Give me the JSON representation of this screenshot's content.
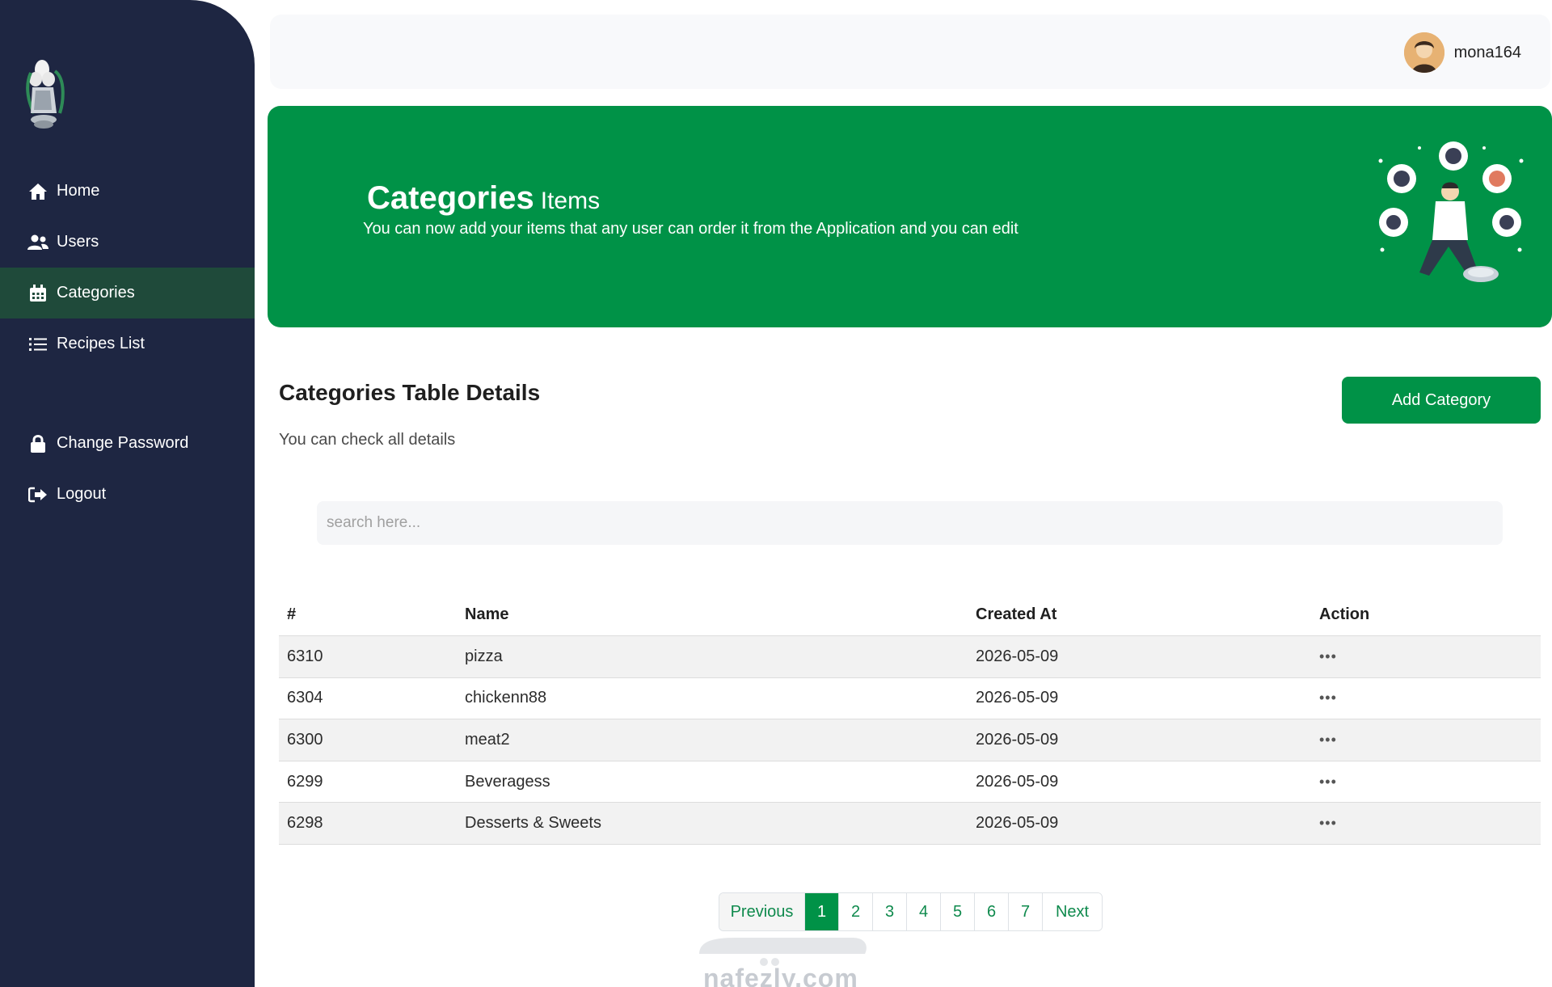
{
  "sidebar": {
    "items": [
      {
        "label": "Home",
        "icon": "home-icon"
      },
      {
        "label": "Users",
        "icon": "users-icon"
      },
      {
        "label": "Categories",
        "icon": "calendar-icon"
      },
      {
        "label": "Recipes List",
        "icon": "list-icon"
      },
      {
        "label": "Change Password",
        "icon": "lock-icon"
      },
      {
        "label": "Logout",
        "icon": "logout-icon"
      }
    ],
    "active": "Categories"
  },
  "topbar": {
    "username": "mona164"
  },
  "banner": {
    "title_big": "Categories",
    "title_small": "Items",
    "subtitle": "You can now add your items that any user can order it from the Application and you can edit"
  },
  "section": {
    "title": "Categories Table Details",
    "subtitle": "You can check all details",
    "add_button": "Add Category"
  },
  "search": {
    "placeholder": "search here..."
  },
  "table": {
    "headers": [
      "#",
      "Name",
      "Created At",
      "Action"
    ],
    "rows": [
      {
        "id": "6310",
        "name": "pizza",
        "created": "2026-05-09",
        "action": "•••"
      },
      {
        "id": "6304",
        "name": "chickenn88",
        "created": "2026-05-09",
        "action": "•••"
      },
      {
        "id": "6300",
        "name": "meat2",
        "created": "2026-05-09",
        "action": "•••"
      },
      {
        "id": "6299",
        "name": "Beveragess",
        "created": "2026-05-09",
        "action": "•••"
      },
      {
        "id": "6298",
        "name": "Desserts & Sweets",
        "created": "2026-05-09",
        "action": "•••"
      }
    ]
  },
  "pagination": {
    "previous": "Previous",
    "pages": [
      "1",
      "2",
      "3",
      "4",
      "5",
      "6",
      "7"
    ],
    "current": "1",
    "next": "Next"
  },
  "watermark": {
    "text": "nafezly.com"
  },
  "colors": {
    "sidebar_bg": "#1e2642",
    "active_item_bg": "#1f4a3a",
    "brand_green": "#009247",
    "link_green": "#0f8a4d"
  }
}
